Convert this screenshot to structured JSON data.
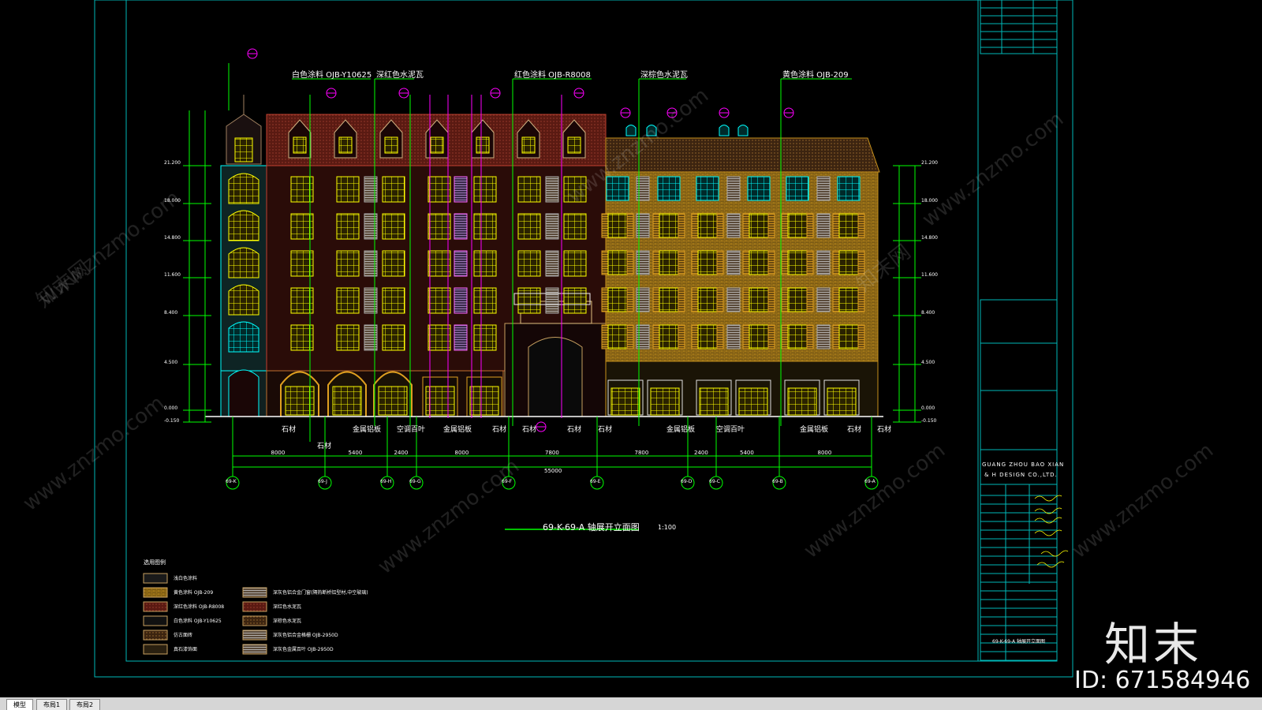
{
  "callouts": {
    "c1": "白色涂料 OJB-Y10625",
    "c2": "深红色水泥瓦",
    "c3": "红色涂料 OJB-R8008",
    "c4": "深棕色水泥瓦",
    "c5": "黄色涂料 OJB-209"
  },
  "materials_bottom": [
    "石材",
    "石材",
    "金属铝板",
    "空调百叶",
    "金属铝板",
    "石材",
    "石材",
    "石材",
    "石材",
    "金属铝板",
    "空调百叶",
    "金属铝板",
    "石材",
    "石材"
  ],
  "dimensions": [
    "8000",
    "5400",
    "2400",
    "8000",
    "7800",
    "7800",
    "2400",
    "5400",
    "8000"
  ],
  "total_dimension": "55000",
  "axes": [
    "69-K",
    "69-J",
    "69-H",
    "69-G",
    "69-F",
    "69-E",
    "69-D",
    "69-C",
    "69-B",
    "69-A"
  ],
  "drawing_title": "69-K-69-A 轴展开立面图",
  "scale": "1:100",
  "elevations": [
    "21.200",
    "18.000",
    "14.800",
    "11.600",
    "8.400",
    "4.500",
    "0.000",
    "-0.150"
  ],
  "legend_header": "选用图例",
  "legend_left": [
    "浅白色涂料",
    "黄色涂料 OJB-209",
    "深红色涂料 OJB-R8008",
    "白色涂料 OJB-Y10625",
    "仿古面砖",
    "真石漆饰面"
  ],
  "legend_right": [
    "深灰色铝合金门窗(隔热断桥铝型材,中空玻璃)",
    "深红色水泥瓦",
    "深棕色水泥瓦",
    "深灰色铝合金格栅 OJB-2950D",
    "深灰色金属百叶 OJB-2950D",
    ""
  ],
  "title_block": {
    "company_en_1": "GUANG ZHOU BAO XIAN",
    "company_en_2": "& H DESIGN CO.,LTD.",
    "block_title": "69-K-69-A 轴展开立面图"
  },
  "tabs": [
    "模型",
    "布局1",
    "布局2"
  ],
  "watermark": "www.znzmo.com",
  "watermark_cn": "知末网",
  "logo": "知末",
  "image_id": "ID: 671584946",
  "colors": {
    "frame": "#00b8b8",
    "roof_red": "#5a1a12",
    "roof_brown": "#4a2c10",
    "wall_yellow": "#c8921c",
    "window_yellow": "#ffff00",
    "window_cyan": "#00ffff",
    "dim_green": "#00ff00",
    "magenta": "#ff00ff"
  }
}
